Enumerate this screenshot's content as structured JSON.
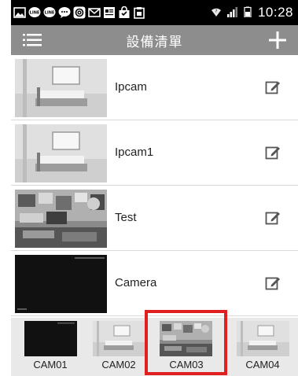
{
  "status_bar": {
    "time": "10:28",
    "icons": [
      "gallery-icon",
      "line-icon",
      "line-icon",
      "chat-icon",
      "at-icon",
      "mail-icon",
      "news-icon",
      "bag-icon",
      "clipboard-icon"
    ]
  },
  "header": {
    "title": "設備清單",
    "menu_icon": "menu-icon",
    "add_icon": "plus-icon"
  },
  "devices": [
    {
      "name": "Ipcam",
      "thumbnail": "bedroom"
    },
    {
      "name": "Ipcam1",
      "thumbnail": "bedroom"
    },
    {
      "name": "Test",
      "thumbnail": "office"
    },
    {
      "name": "Camera",
      "thumbnail": "dark"
    }
  ],
  "cameras": [
    {
      "label": "CAM01",
      "thumbnail": "dark",
      "selected": false
    },
    {
      "label": "CAM02",
      "thumbnail": "bedroom",
      "selected": false
    },
    {
      "label": "CAM03",
      "thumbnail": "office",
      "selected": true
    },
    {
      "label": "CAM04",
      "thumbnail": "bedroom",
      "selected": false
    }
  ],
  "colors": {
    "header_bg": "#8d8d8d",
    "status_bg": "#000000",
    "strip_bg": "#e9e9e9",
    "highlight": "#e02020"
  }
}
